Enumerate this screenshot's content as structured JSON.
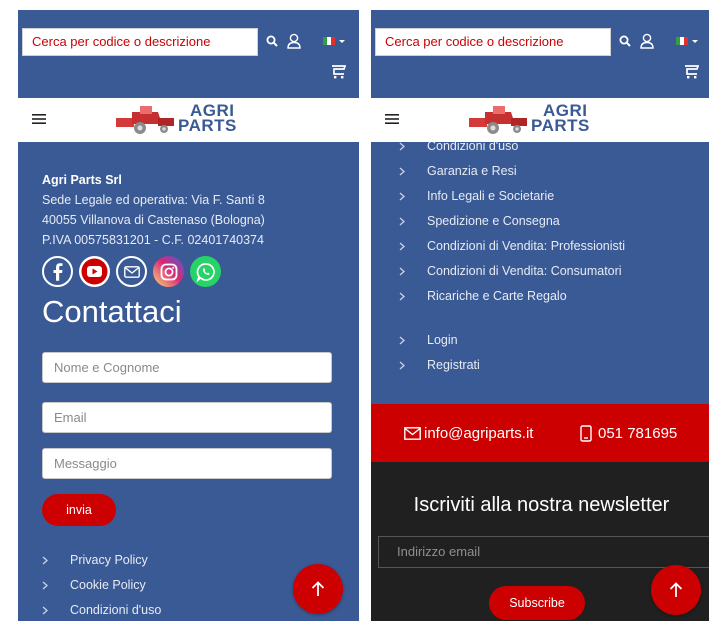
{
  "colors": {
    "brand_blue": "#3a5a95",
    "accent_red": "#cc0000",
    "newsletter_bg": "#202020"
  },
  "header": {
    "search_placeholder": "Cerca per codice o descrizione",
    "icons": [
      "search-icon",
      "user-icon",
      "italian-flag-icon",
      "cart-icon",
      "menu-icon"
    ],
    "logo_line1": "AGRI",
    "logo_line2": "PARTS"
  },
  "company": {
    "name": "Agri Parts Srl",
    "address1": "Sede Legale ed operativa: Via F. Santi 8",
    "address2": "40055 Villanova di Castenaso (Bologna)",
    "tax": "P.IVA 00575831201 - C.F. 02401740374"
  },
  "socials": [
    "facebook-icon",
    "youtube-icon",
    "email-icon",
    "instagram-icon",
    "whatsapp-icon"
  ],
  "contact_form": {
    "title": "Contattaci",
    "name_placeholder": "Nome e Cognome",
    "email_placeholder": "Email",
    "message_placeholder": "Messaggio",
    "send_label": "invia"
  },
  "footer_links_left": [
    "Privacy Policy",
    "Cookie Policy",
    "Condizioni d'uso"
  ],
  "footer_links_right": [
    "Condizioni d'uso",
    "Garanzia e Resi",
    "Info Legali e Societarie",
    "Spedizione e Consegna",
    "Condizioni di Vendita: Professionisti",
    "Condizioni di Vendita: Consumatori",
    "Ricariche e Carte Regalo"
  ],
  "account_links": [
    "Login",
    "Registrati"
  ],
  "contact_bar": {
    "email": "info@agriparts.it",
    "phone": "051 781695"
  },
  "newsletter": {
    "title": "Iscriviti alla nostra newsletter",
    "placeholder": "Indirizzo email",
    "button": "Subscribe"
  }
}
